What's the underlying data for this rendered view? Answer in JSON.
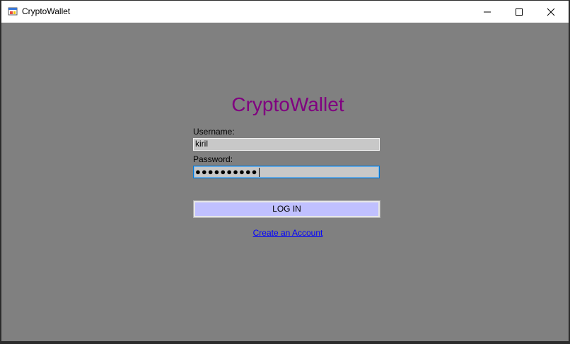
{
  "window": {
    "title": "CryptoWallet",
    "controls": {
      "minimize": "minimize",
      "maximize": "maximize",
      "close": "close"
    }
  },
  "form": {
    "heading": "CryptoWallet",
    "username_label": "Username:",
    "username_value": "kiril",
    "password_label": "Password:",
    "password_masked": "●●●●●●●●●●",
    "login_label": "LOG IN",
    "create_account_label": "Create an Account"
  },
  "colors": {
    "background": "#808080",
    "heading": "#800080",
    "input_bg": "#c8c8c8",
    "button_bg": "#c0c0ff",
    "link": "#0000ff"
  }
}
